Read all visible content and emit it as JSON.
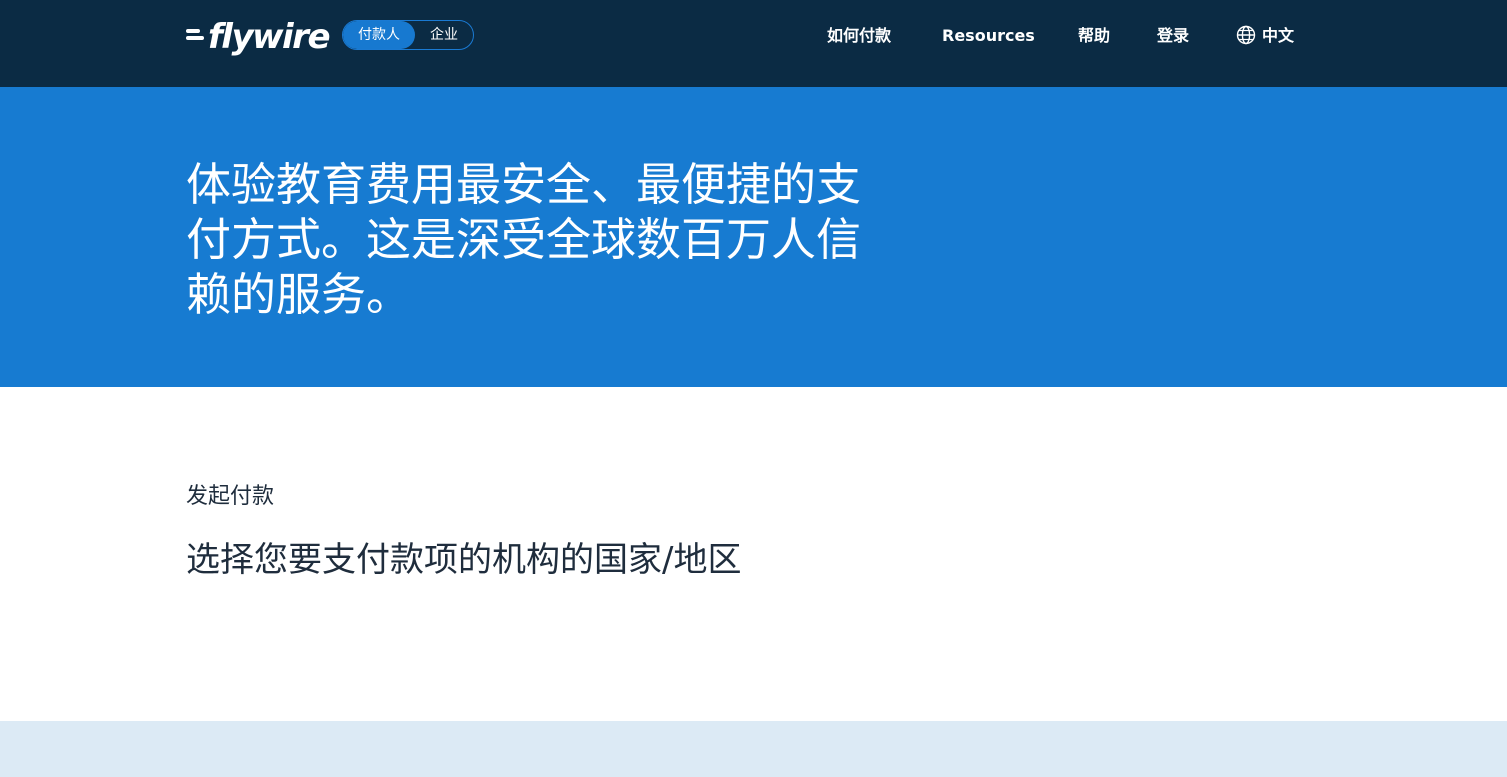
{
  "header": {
    "logo_text": "flywire",
    "toggle": [
      {
        "label": "付款人",
        "active": true
      },
      {
        "label": "企业",
        "active": false
      }
    ],
    "nav": {
      "how_to_pay": "如何付款",
      "resources": "Resources",
      "help": "帮助",
      "login": "登录",
      "language": "中文"
    },
    "icons": {
      "language": "globe-icon"
    }
  },
  "hero": {
    "title_lines": [
      "体验教育费用最安全、最便捷的支",
      "付方式。这是深受全球数百万人信",
      "赖的服务。"
    ]
  },
  "payment": {
    "label": "发起付款",
    "heading": "选择您要支付款项的机构的国家/地区"
  },
  "colors": {
    "header_bg": "#0b2b44",
    "hero_bg": "#177bd1",
    "toggle_active": "#1779d0",
    "text_dark": "#1f2d3d",
    "footer_band": "#dceaf5"
  }
}
